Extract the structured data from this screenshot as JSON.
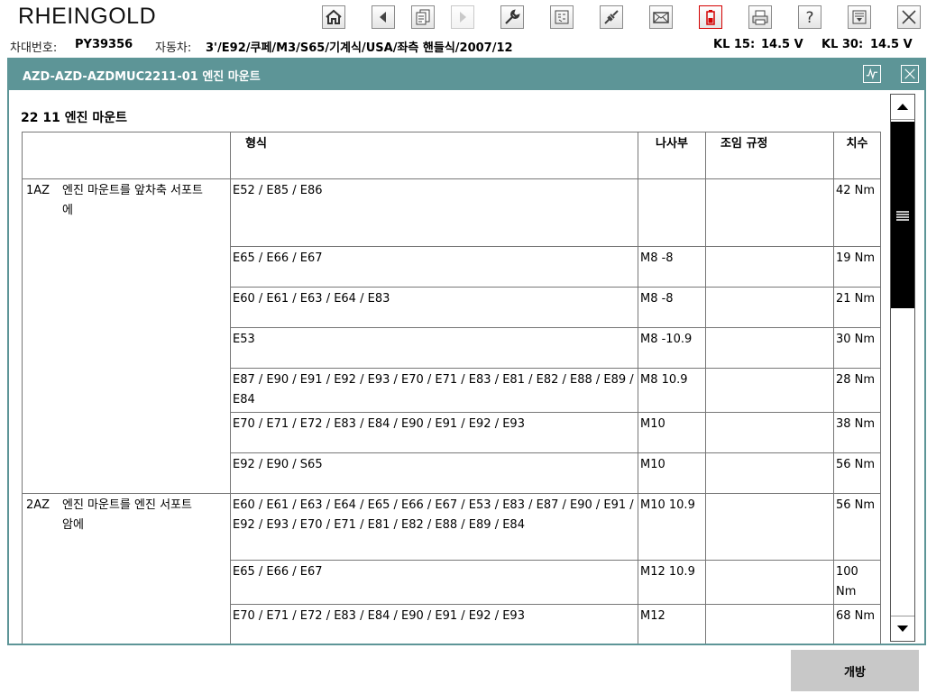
{
  "app": {
    "title": "RHEINGOLD"
  },
  "toolbar": {
    "icons": [
      "home-icon",
      "back-icon",
      "documents-icon",
      "forward-icon",
      "wrench-icon",
      "measurement-icon",
      "connection-icon",
      "mail-icon",
      "battery-icon",
      "print-icon",
      "help-icon",
      "menu-dropdown-icon",
      "close-icon"
    ],
    "alert_color": "#d40000"
  },
  "vehicle_info": {
    "vin_label": "차대번호:",
    "vin_value": "PY39356",
    "car_label": "자동차:",
    "car_value": "3'/E92/쿠페/M3/S65/기계식/USA/좌측 핸들식/2007/12",
    "kl15_label": "KL 15:",
    "kl15_value": "14.5 V",
    "kl30_label": "KL 30:",
    "kl30_value": "14.5 V"
  },
  "document": {
    "title": "AZD-AZD-AZDMUC2211-01 엔진 마운트",
    "accent_color": "#5d9597",
    "section_title": "22 11 엔진 마운트",
    "table": {
      "headers": {
        "item": "",
        "model": "형식",
        "thread": "나사부",
        "assembly": "조임 규정",
        "value": "치수"
      },
      "rows": [
        {
          "code": "1AZ",
          "desc": "엔진 마운트를 앞차축 서포트에",
          "model": "E52 / E85 / E86",
          "thread": "",
          "assembly": "",
          "value": "42 Nm"
        },
        {
          "code": "",
          "desc": "",
          "model": "E65 / E66 / E67",
          "thread": "M8 -8",
          "assembly": "",
          "value": "19 Nm"
        },
        {
          "code": "",
          "desc": "",
          "model": "E60 / E61 / E63 / E64 / E83",
          "thread": "M8 -8",
          "assembly": "",
          "value": "21 Nm"
        },
        {
          "code": "",
          "desc": "",
          "model": "E53",
          "thread": "M8 -10.9",
          "assembly": "",
          "value": "30 Nm"
        },
        {
          "code": "",
          "desc": "",
          "model": "E87 / E90 / E91 / E92 / E93 / E70 / E71 / E83 / E81 / E82 / E88 / E89 / E84",
          "thread": "M8 10.9",
          "assembly": "",
          "value": "28 Nm"
        },
        {
          "code": "",
          "desc": "",
          "model": "E70 / E71 / E72 / E83 / E84 / E90 / E91 / E92 / E93",
          "thread": "M10",
          "assembly": "",
          "value": "38 Nm"
        },
        {
          "code": "",
          "desc": "",
          "model": "E92 / E90 / S65",
          "thread": "M10",
          "assembly": "",
          "value": "56 Nm"
        },
        {
          "code": "2AZ",
          "desc": "엔진 마운트를 엔진 서포트 암에",
          "model": "E60 / E61 / E63 / E64 / E65 / E66 / E67 / E53 / E83 / E87 / E90 / E91 / E92 / E93 / E70 / E71 / E81 / E82 / E88 / E89 / E84",
          "thread": "M10 10.9",
          "assembly": "",
          "value": "56 Nm"
        },
        {
          "code": "",
          "desc": "",
          "model": "E65 / E66 / E67",
          "thread": "M12 10.9",
          "assembly": "",
          "value": "100 Nm"
        },
        {
          "code": "",
          "desc": "",
          "model": "E70 / E71 / E72 / E83 / E84 / E90 / E91 / E92 / E93",
          "thread": "M12",
          "assembly": "",
          "value": "68 Nm"
        },
        {
          "code": "",
          "desc": "",
          "model": "",
          "thread": "",
          "assembly": "",
          "value": ""
        }
      ]
    }
  },
  "footer": {
    "open_label": "개방"
  }
}
